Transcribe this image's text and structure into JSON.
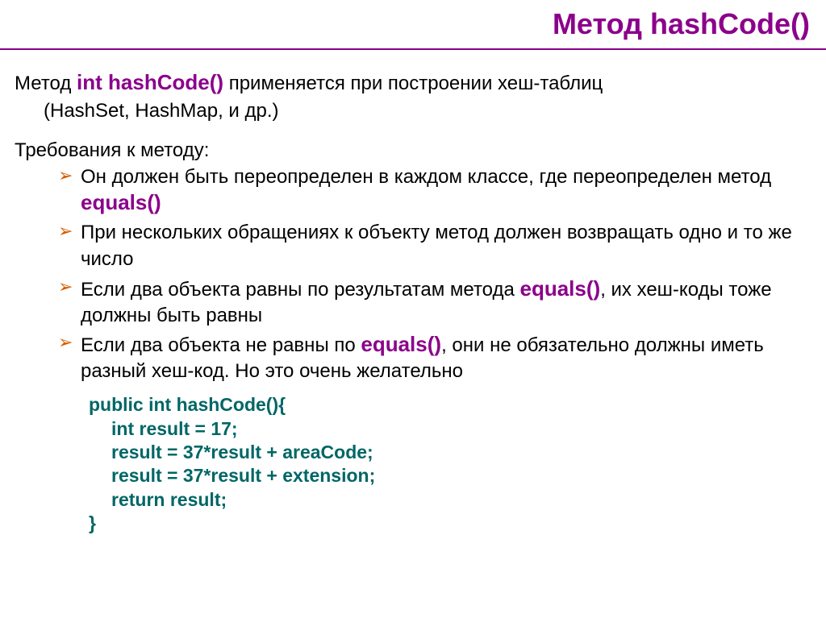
{
  "header": {
    "title": "Метод hashCode()"
  },
  "intro": {
    "prefix": "Метод ",
    "highlight": "int hashCode()",
    "suffix": " применяется при построении хеш-таблиц",
    "subline": "(HashSet, HashMap, и др.)"
  },
  "requirements": {
    "heading": "Требования к методу:",
    "items": [
      {
        "before": "Он должен быть переопределен в каждом классе, где переопределен метод ",
        "hl": "equals()",
        "after": ""
      },
      {
        "before": "При нескольких обращениях к объекту метод должен возвращать одно и то же число",
        "hl": "",
        "after": ""
      },
      {
        "before": "Если два объекта равны по результатам метода ",
        "hl": "equals()",
        "after": ", их хеш-коды тоже должны быть равны"
      },
      {
        "before": "Если два объекта не равны по ",
        "hl": "equals()",
        "after": ", они не обязательно должны иметь разный хеш-код. Но это очень желательно"
      }
    ]
  },
  "code": {
    "l1": "public int hashCode(){",
    "l2": "int result = 17;",
    "l3": "result = 37*result + areaCode;",
    "l4": "result = 37*result + extension;",
    "l5": "return result;",
    "l6": "}"
  }
}
